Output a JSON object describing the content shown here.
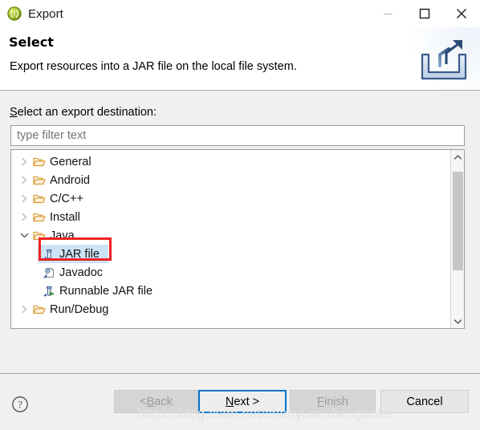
{
  "window": {
    "title": "Export",
    "app_icon": "eclipse-export-icon",
    "controls": [
      {
        "name": "minimize",
        "glyph": "minimize-icon",
        "enabled": false
      },
      {
        "name": "maximize",
        "glyph": "maximize-icon",
        "enabled": true
      },
      {
        "name": "close",
        "glyph": "close-icon",
        "enabled": true
      }
    ]
  },
  "header": {
    "title": "Select",
    "description": "Export resources into a JAR file on the local file system.",
    "banner_icon": "export-tray-arrow-icon"
  },
  "main": {
    "destination_label_mnemonic": "S",
    "destination_label_rest": "elect an export destination:",
    "filter": {
      "value": "",
      "placeholder": "type filter text"
    },
    "tree": [
      {
        "label": "General",
        "icon": "folder-icon",
        "depth": 1,
        "expander": "collapsed",
        "selected": false
      },
      {
        "label": "Android",
        "icon": "folder-icon",
        "depth": 1,
        "expander": "collapsed",
        "selected": false
      },
      {
        "label": "C/C++",
        "icon": "folder-icon",
        "depth": 1,
        "expander": "collapsed",
        "selected": false
      },
      {
        "label": "Install",
        "icon": "folder-icon",
        "depth": 1,
        "expander": "collapsed",
        "selected": false
      },
      {
        "label": "Java",
        "icon": "folder-icon",
        "depth": 1,
        "expander": "expanded",
        "selected": false
      },
      {
        "label": "JAR file",
        "icon": "jar-file-icon",
        "depth": 2,
        "expander": "none",
        "selected": true
      },
      {
        "label": "Javadoc",
        "icon": "javadoc-icon",
        "depth": 2,
        "expander": "none",
        "selected": false
      },
      {
        "label": "Runnable JAR file",
        "icon": "runnable-jar-file-icon",
        "depth": 2,
        "expander": "none",
        "selected": false
      },
      {
        "label": "Run/Debug",
        "icon": "folder-icon",
        "depth": 1,
        "expander": "collapsed",
        "selected": false
      }
    ],
    "scrollbar": {
      "up_icon": "chevron-up-icon",
      "down_icon": "chevron-down-icon"
    },
    "annotation": {
      "type": "red-rectangle",
      "target": "JAR file",
      "color": "#ee2222"
    }
  },
  "footer": {
    "help_icon": "help-question-icon",
    "buttons": [
      {
        "name": "back",
        "label_pre": "< ",
        "mnemonic": "B",
        "label_post": "ack",
        "enabled": false,
        "focused": false
      },
      {
        "name": "next",
        "label_pre": "",
        "mnemonic": "N",
        "label_post": "ext >",
        "enabled": true,
        "focused": true
      },
      {
        "name": "finish",
        "label_pre": "",
        "mnemonic": "F",
        "label_post": "inish",
        "enabled": false,
        "focused": false
      },
      {
        "name": "cancel",
        "label_pre": "",
        "mnemonic": "",
        "label_post": "Cancel",
        "enabled": true,
        "focused": false
      }
    ]
  },
  "watermark": "https://blog.csdn.net/chenyuanshengboke",
  "colors": {
    "focus_blue": "#0a73c8",
    "selection_blue": "#cce3f5",
    "annotation_red": "#ee2222",
    "dialog_grey": "#f0f0f0",
    "folder_orange": "#e8a33d"
  }
}
